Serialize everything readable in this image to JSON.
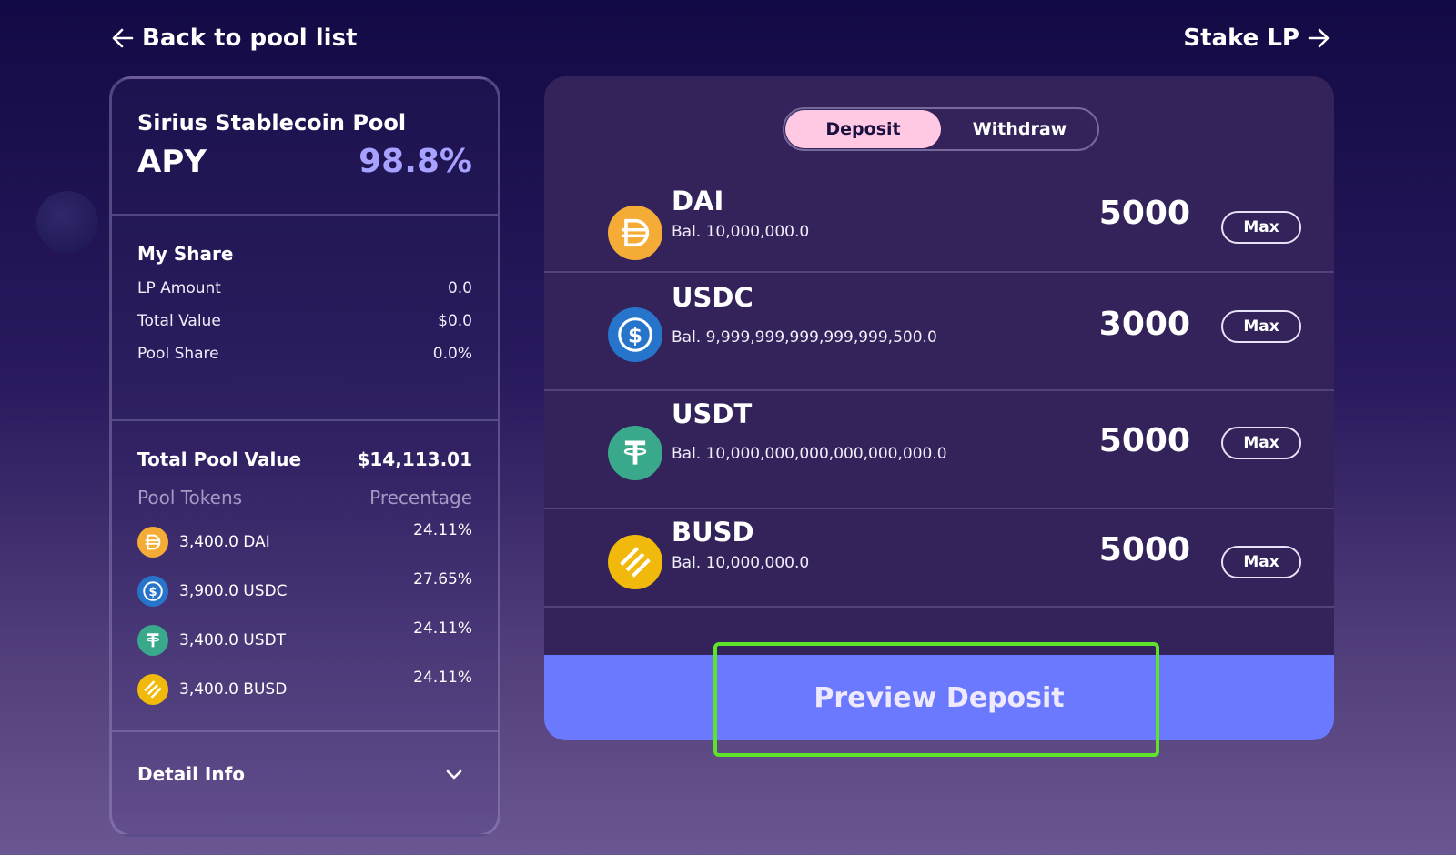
{
  "nav": {
    "back_label": "Back to pool list",
    "stake_label": "Stake LP"
  },
  "pool": {
    "name": "Sirius Stablecoin Pool",
    "apy_label": "APY",
    "apy_value": "98.8%"
  },
  "my_share": {
    "title": "My Share",
    "rows": [
      {
        "label": "LP Amount",
        "value": "0.0"
      },
      {
        "label": "Total Value",
        "value": "$0.0"
      },
      {
        "label": "Pool Share",
        "value": "0.0%"
      }
    ]
  },
  "total_pool": {
    "label": "Total Pool Value",
    "value": "$14,113.01",
    "col_tokens": "Pool Tokens",
    "col_pct": "Precentage",
    "tokens": [
      {
        "icon": "dai-icon",
        "amount": "3,400.0 DAI",
        "pct": "24.11%"
      },
      {
        "icon": "usdc-icon",
        "amount": "3,900.0 USDC",
        "pct": "27.65%"
      },
      {
        "icon": "usdt-icon",
        "amount": "3,400.0 USDT",
        "pct": "24.11%"
      },
      {
        "icon": "busd-icon",
        "amount": "3,400.0 BUSD",
        "pct": "24.11%"
      }
    ]
  },
  "detail": {
    "label": "Detail Info"
  },
  "tabs": {
    "deposit": "Deposit",
    "withdraw": "Withdraw",
    "active": "Deposit"
  },
  "deposit_rows": [
    {
      "symbol": "DAI",
      "balance": "Bal. 10,000,000.0",
      "amount": "5000",
      "max_label": "Max"
    },
    {
      "symbol": "USDC",
      "balance": "Bal. 9,999,999,999,999,999,500.0",
      "amount": "3000",
      "max_label": "Max"
    },
    {
      "symbol": "USDT",
      "balance": "Bal. 10,000,000,000,000,000,000.0",
      "amount": "5000",
      "max_label": "Max"
    },
    {
      "symbol": "BUSD",
      "balance": "Bal. 10,000,000.0",
      "amount": "5000",
      "max_label": "Max"
    }
  ],
  "preview_label": "Preview Deposit",
  "colors": {
    "accent": "#6b79ff",
    "apy": "#a7a1ff",
    "tab_active": "#ffc8e3",
    "highlight": "#5ee22b",
    "dai": "#f5ac37",
    "usdc": "#2775ca",
    "usdt": "#3aa88b",
    "busd": "#f0b90b"
  }
}
